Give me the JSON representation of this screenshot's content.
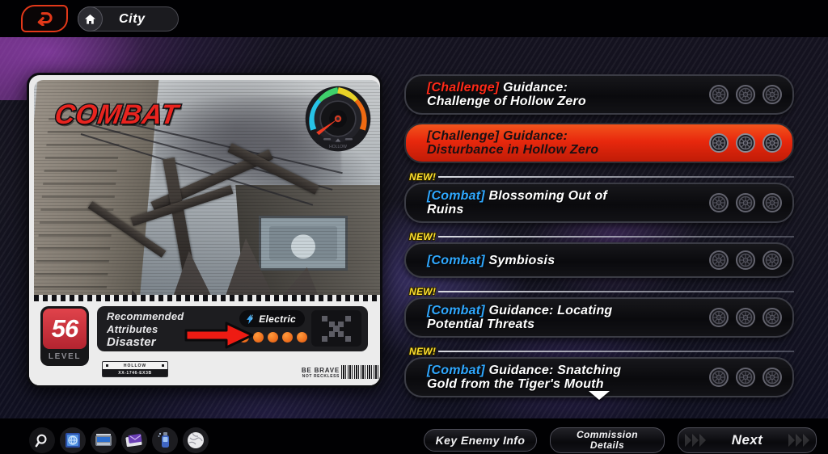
{
  "topbar": {
    "back_icon": "back-arrow-icon",
    "home_icon": "home-icon",
    "breadcrumb_label": "City"
  },
  "card": {
    "category_title": "COMBAT",
    "gauge_icon": "difficulty-gauge-icon",
    "level_value": "56",
    "level_label": "LEVEL",
    "recommended_label": "Recommended\nAttributes",
    "recommended_line1": "Recommended",
    "recommended_line2": "Attributes",
    "attribute_value": "Disaster",
    "element_icon": "electric-icon",
    "element_name": "Electric",
    "difficulty_dots": 5,
    "qr_icon": "qr-code-icon",
    "hollow_tag_title": "HOLLOW",
    "hollow_tag_code": "XX-1746-EX3B",
    "slogan_line1": "BE BRAVE",
    "slogan_line2": "NOT RECKLESS",
    "barcode_icon": "barcode-icon",
    "pointer_icon": "red-arrow-pointer-icon"
  },
  "missions": [
    {
      "is_new": false,
      "new_label": "",
      "tag": "[Challenge]",
      "tag_type": "challenge",
      "title": " Guidance:\nChallenge of Hollow Zero",
      "title_line1": " Guidance:",
      "title_line2": "Challenge of Hollow Zero",
      "selected": false,
      "medals": 3
    },
    {
      "is_new": false,
      "new_label": "",
      "tag": "[Challenge]",
      "tag_type": "challenge",
      "title": " Guidance:\nDisturbance in Hollow Zero",
      "title_line1": " Guidance:",
      "title_line2": "Disturbance in Hollow Zero",
      "selected": true,
      "medals": 3
    },
    {
      "is_new": true,
      "new_label": "NEW!",
      "tag": "[Combat]",
      "tag_type": "combat",
      "title": " Blossoming Out of\nRuins",
      "title_line1": " Blossoming Out of",
      "title_line2": "Ruins",
      "selected": false,
      "medals": 3
    },
    {
      "is_new": true,
      "new_label": "NEW!",
      "tag": "[Combat]",
      "tag_type": "combat",
      "title": " Symbiosis",
      "title_line1": " Symbiosis",
      "title_line2": "",
      "selected": false,
      "medals": 3
    },
    {
      "is_new": true,
      "new_label": "NEW!",
      "tag": "[Combat]",
      "tag_type": "combat",
      "title": " Guidance: Locating\nPotential Threats",
      "title_line1": " Guidance: Locating",
      "title_line2": "Potential Threats",
      "selected": false,
      "medals": 3
    },
    {
      "is_new": true,
      "new_label": "NEW!",
      "tag": "[Combat]",
      "tag_type": "combat",
      "title": " Guidance: Snatching\nGold from the Tiger's Mouth",
      "title_line1": " Guidance: Snatching",
      "title_line2": "Gold from the Tiger's Mouth",
      "selected": false,
      "medals": 3
    }
  ],
  "scroll_hint_icon": "chevron-down-icon",
  "dock": [
    {
      "name": "search-icon",
      "label": ""
    },
    {
      "name": "encyclopedia-icon",
      "label": ""
    },
    {
      "name": "device-icon",
      "label": ""
    },
    {
      "name": "mail-icon",
      "label": ""
    },
    {
      "name": "spray-can-icon",
      "label": ""
    },
    {
      "name": "sphere-icon",
      "label": ""
    }
  ],
  "footer": {
    "key_enemy_info_label": "Key Enemy Info",
    "commission_details_line1": "Commission",
    "commission_details_line2": "Details",
    "next_label": "Next"
  },
  "colors": {
    "accent_red": "#e8280d",
    "tag_challenge": "#ff2a18",
    "tag_combat": "#2fa8ff",
    "new_yellow": "#ffe02e",
    "element_orange": "#e2560c",
    "level_red": "#c8303a"
  }
}
